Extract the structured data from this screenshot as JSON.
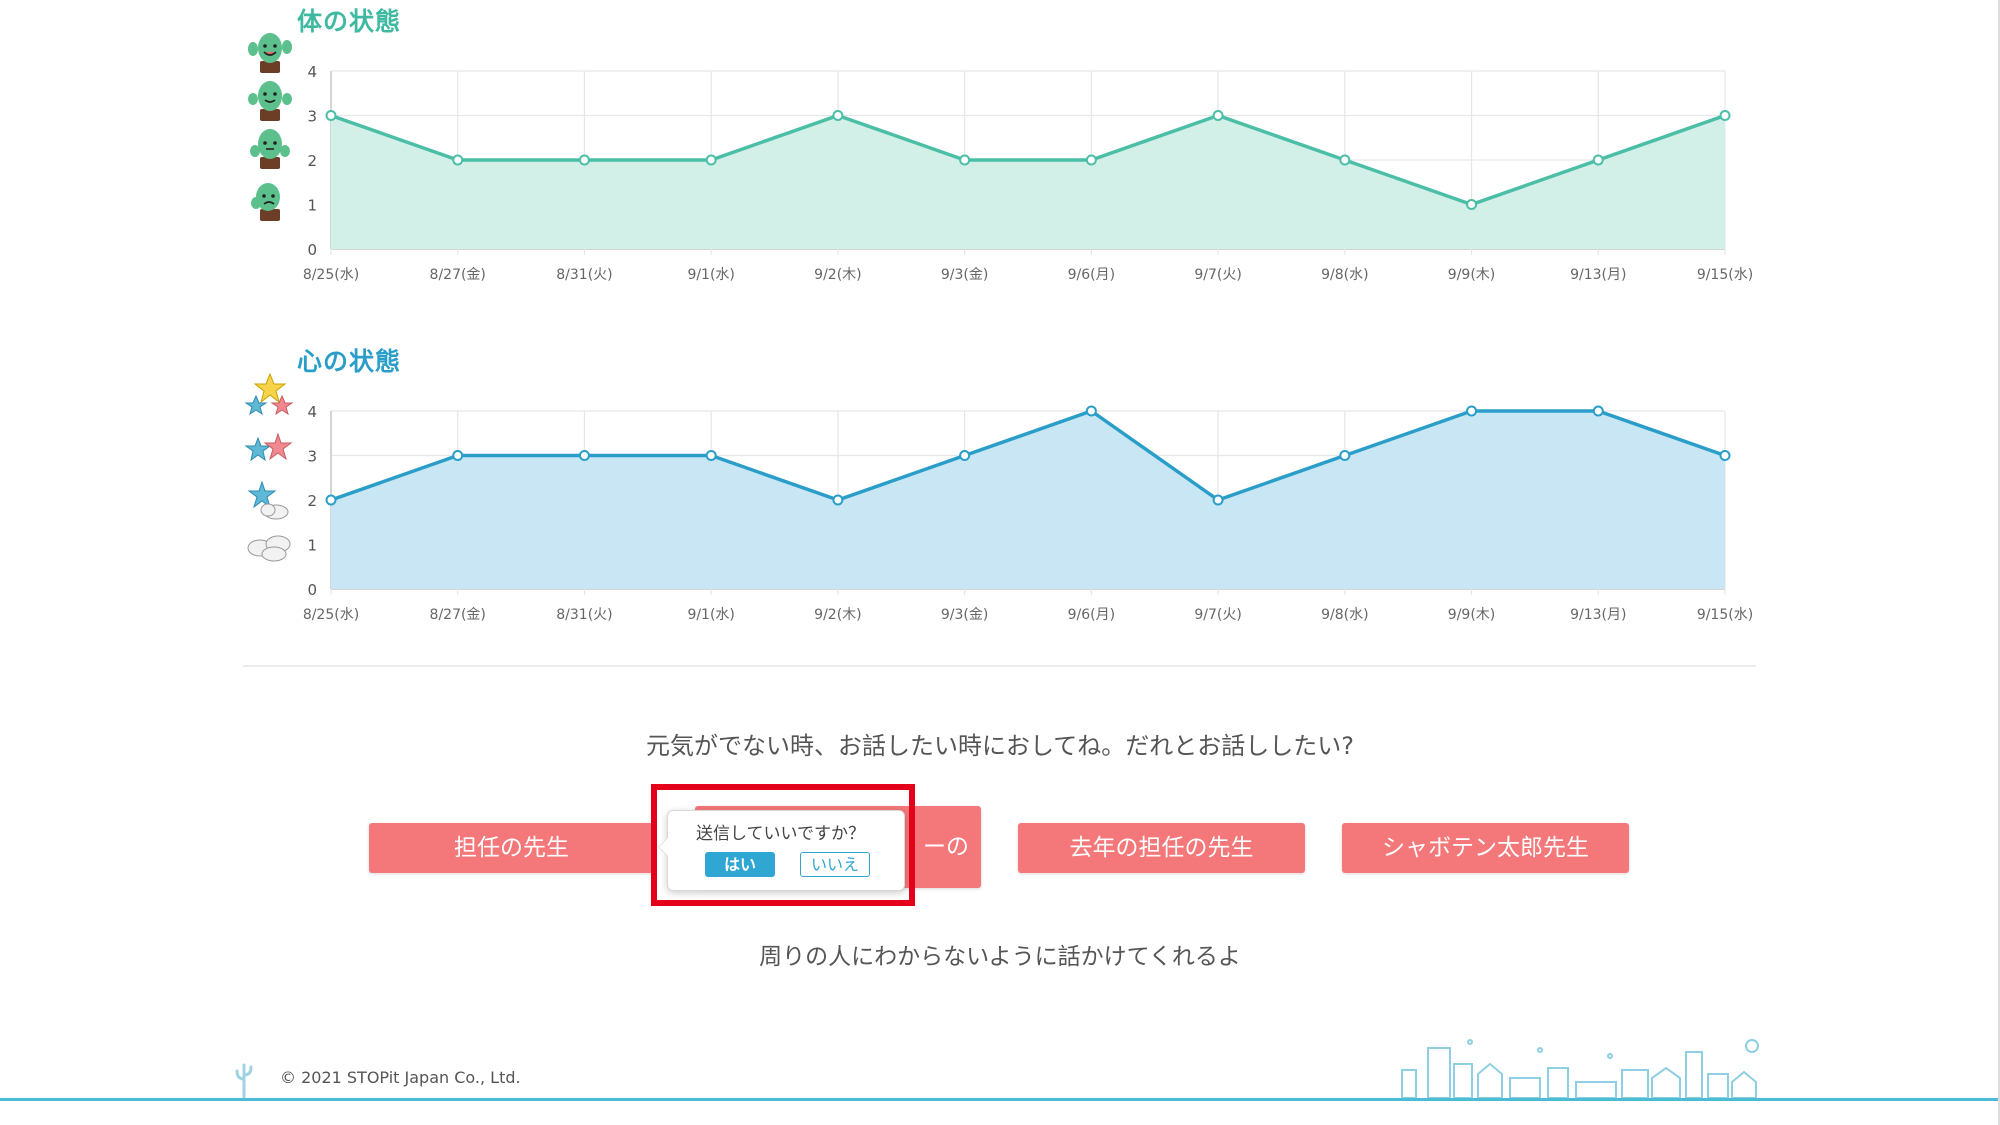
{
  "colors": {
    "body_line": "#4bbfa6",
    "body_fill": "#d2efe8",
    "body_title": "#3fb9a0",
    "mind_line": "#2a9ec8",
    "mind_fill": "#c8e6f4",
    "mind_title": "#2a9ec8",
    "button": "#f47779",
    "highlight": "#e4001b"
  },
  "body_chart": {
    "title": "体の状態",
    "icons": [
      "cactus-happy-icon",
      "cactus-smile-icon",
      "cactus-neutral-icon",
      "cactus-sad-icon"
    ]
  },
  "mind_chart": {
    "title": "心の状態",
    "icons": [
      "three-stars-icon",
      "two-stars-icon",
      "star-cloud-icon",
      "clouds-icon"
    ]
  },
  "chart_data": [
    {
      "type": "area",
      "title": "体の状態",
      "categories": [
        "8/25(水)",
        "8/27(金)",
        "8/31(火)",
        "9/1(水)",
        "9/2(木)",
        "9/3(金)",
        "9/6(月)",
        "9/7(火)",
        "9/8(水)",
        "9/9(木)",
        "9/13(月)",
        "9/15(水)"
      ],
      "values": [
        3,
        2,
        2,
        2,
        3,
        2,
        2,
        3,
        2,
        1,
        2,
        3
      ],
      "yticks": [
        0,
        1,
        2,
        3,
        4
      ],
      "ylim": [
        0,
        4
      ],
      "grid": true
    },
    {
      "type": "area",
      "title": "心の状態",
      "categories": [
        "8/25(水)",
        "8/27(金)",
        "8/31(火)",
        "9/1(水)",
        "9/2(木)",
        "9/3(金)",
        "9/6(月)",
        "9/7(火)",
        "9/8(水)",
        "9/9(木)",
        "9/13(月)",
        "9/15(水)"
      ],
      "values": [
        2,
        3,
        3,
        3,
        2,
        3,
        4,
        2,
        3,
        4,
        4,
        3
      ],
      "yticks": [
        0,
        1,
        2,
        3,
        4
      ],
      "ylim": [
        0,
        4
      ],
      "grid": true
    }
  ],
  "prompt": "元気がでない時、お話したい時におしてね。だれとお話ししたい?",
  "buttons": {
    "homeroom": "担任の先生",
    "counselor": "ーの",
    "last_year": "去年の担任の先生",
    "taro": "シャボテン太郎先生"
  },
  "popover": {
    "question": "送信していいですか？",
    "yes": "はい",
    "no": "いいえ"
  },
  "note": "周りの人にわからないように話かけてくれるよ",
  "footer": {
    "copyright": "© 2021 STOPit Japan Co., Ltd."
  }
}
